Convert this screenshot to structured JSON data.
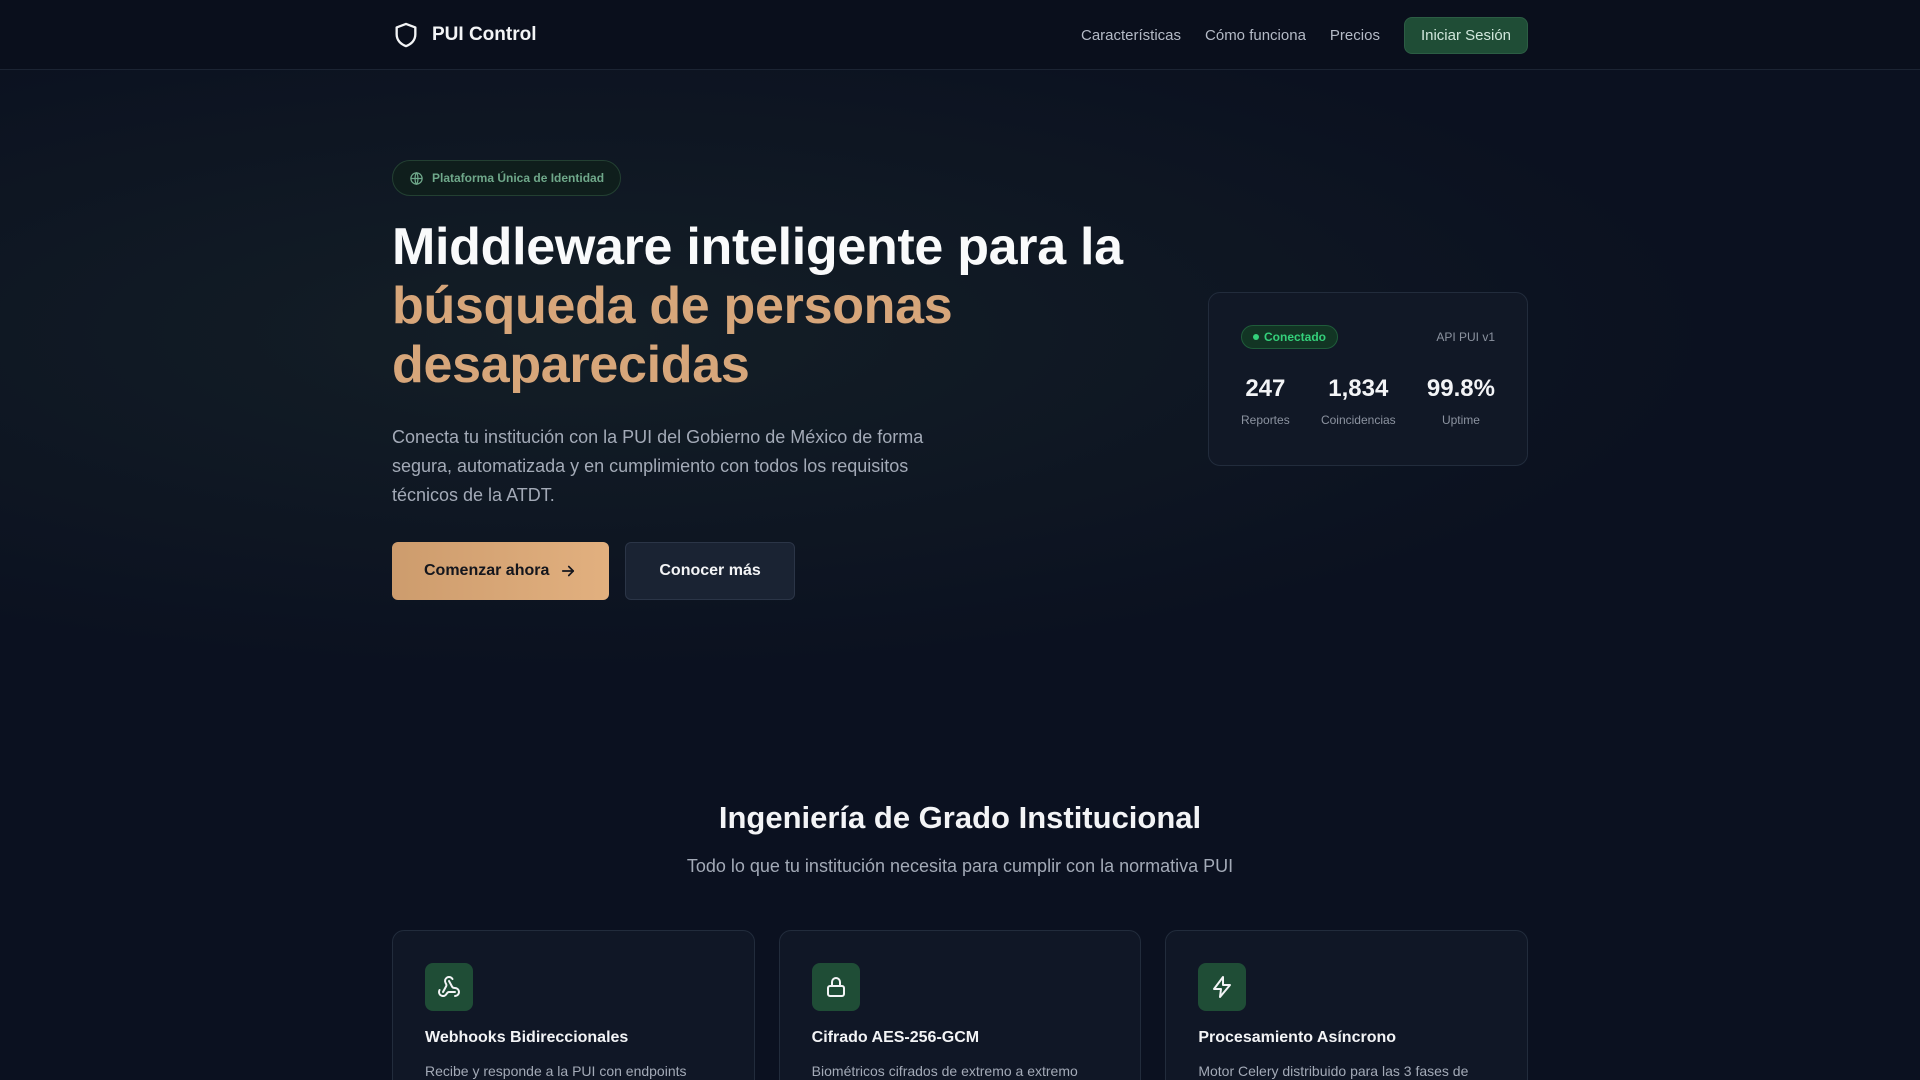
{
  "nav": {
    "brand": "PUI Control",
    "links": [
      "Características",
      "Cómo funciona",
      "Precios"
    ],
    "login": "Iniciar Sesión"
  },
  "hero": {
    "pill": "Plataforma Única de Identidad",
    "title_line1": "Middleware inteligente para la",
    "title_accent_line1": "búsqueda de personas",
    "title_accent_line2": "desaparecidas",
    "lead": "Conecta tu institución con la PUI del Gobierno de México de forma segura, automatizada y en cumplimiento con todos los requisitos técnicos de la ATDT.",
    "cta_primary": "Comenzar ahora",
    "cta_secondary": "Conocer más"
  },
  "status": {
    "badge": "Conectado",
    "api": "API PUI v1",
    "stats": [
      {
        "value": "247",
        "label": "Reportes"
      },
      {
        "value": "1,834",
        "label": "Coincidencias"
      },
      {
        "value": "99.8%",
        "label": "Uptime"
      }
    ]
  },
  "features": {
    "title": "Ingeniería de Grado Institucional",
    "subtitle": "Todo lo que tu institución necesita para cumplir con la normativa PUI",
    "cards": [
      {
        "icon": "webhook-icon",
        "title": "Webhooks Bidireccionales",
        "desc": "Recibe y responde a la PUI con endpoints"
      },
      {
        "icon": "lock-icon",
        "title": "Cifrado AES-256-GCM",
        "desc": "Biométricos cifrados de extremo a extremo"
      },
      {
        "icon": "zap-icon",
        "title": "Procesamiento Asíncrono",
        "desc": "Motor Celery distribuido para las 3 fases de"
      }
    ]
  },
  "colors": {
    "background": "#0b1120",
    "accent": "#d7a67a",
    "green": "#1f4d36",
    "status_green": "#34d07a"
  }
}
